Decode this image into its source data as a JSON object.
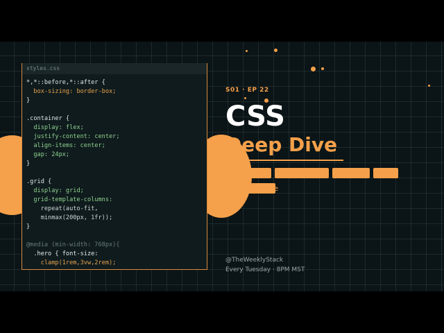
{
  "editor": {
    "filename": "styles.css",
    "lines": [
      [
        {
          "t": "*,*::before,*::after {",
          "c": "sel"
        }
      ],
      [
        {
          "t": "  box-sizing: ",
          "c": "val"
        },
        {
          "t": "border-box;",
          "c": "val"
        }
      ],
      [
        {
          "t": "}",
          "c": "sel"
        }
      ],
      [
        {
          "t": "",
          "c": "sel"
        }
      ],
      [
        {
          "t": ".container {",
          "c": "sel"
        }
      ],
      [
        {
          "t": "  display: ",
          "c": "prop"
        },
        {
          "t": "flex;",
          "c": "prop"
        }
      ],
      [
        {
          "t": "  justify-content: ",
          "c": "prop"
        },
        {
          "t": "center;",
          "c": "prop"
        }
      ],
      [
        {
          "t": "  align-items: ",
          "c": "prop"
        },
        {
          "t": "center;",
          "c": "prop"
        }
      ],
      [
        {
          "t": "  gap: ",
          "c": "prop"
        },
        {
          "t": "24px;",
          "c": "prop"
        }
      ],
      [
        {
          "t": "}",
          "c": "sel"
        }
      ],
      [
        {
          "t": "",
          "c": "sel"
        }
      ],
      [
        {
          "t": ".grid {",
          "c": "sel"
        }
      ],
      [
        {
          "t": "  display: ",
          "c": "prop"
        },
        {
          "t": "grid;",
          "c": "prop"
        }
      ],
      [
        {
          "t": "  grid-template-columns:",
          "c": "prop"
        }
      ],
      [
        {
          "t": "    repeat(auto-fit,",
          "c": "fn"
        }
      ],
      [
        {
          "t": "    minmax(200px, 1fr));",
          "c": "fn"
        }
      ],
      [
        {
          "t": "}",
          "c": "sel"
        }
      ],
      [
        {
          "t": "",
          "c": "sel"
        }
      ],
      [
        {
          "t": "@media (min-width: 768px){",
          "c": "dim"
        }
      ],
      [
        {
          "t": "  .hero { font-size:",
          "c": "hero"
        }
      ],
      [
        {
          "t": "    clamp(1rem,3vw,2rem);",
          "c": "val"
        }
      ]
    ]
  },
  "episode": "S01 · EP 22",
  "title_line1": "CSS",
  "title_line2": "Deep Dive",
  "title_partial": "e",
  "handle": "@TheWeeklyStack",
  "schedule": "Every Tuesday · 8PM MST",
  "colors": {
    "accent": "#f5a04a",
    "background": "#0b1416",
    "panel": "#0f1b1d"
  }
}
